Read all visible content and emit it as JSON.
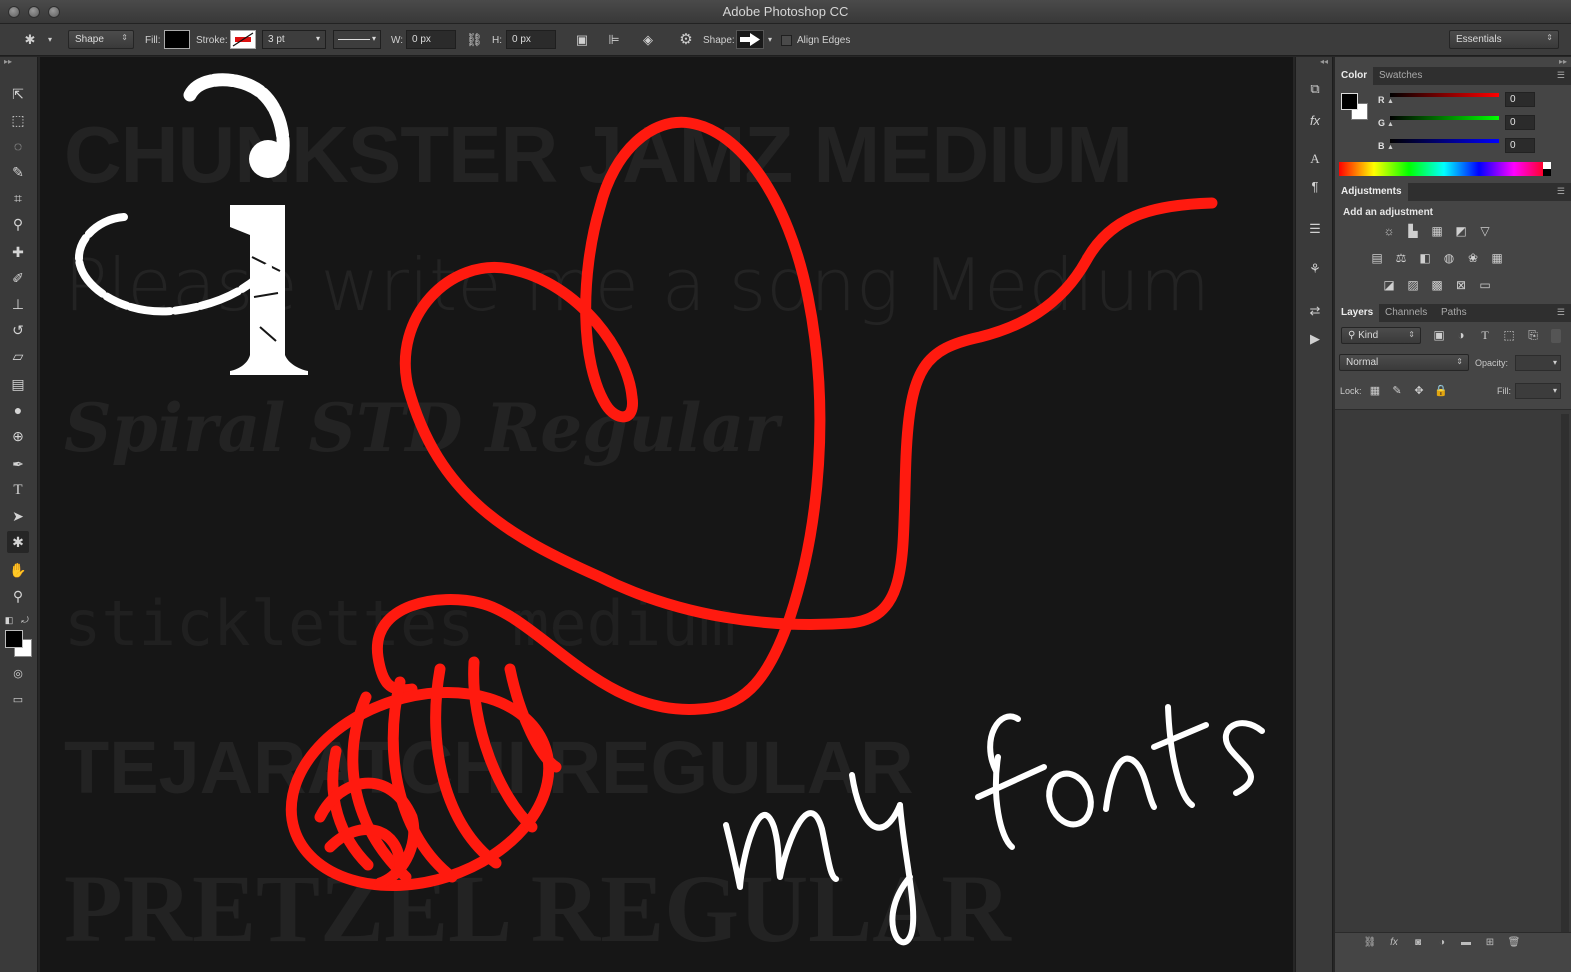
{
  "window": {
    "title": "Adobe Photoshop CC"
  },
  "options_bar": {
    "mode": "Shape",
    "fill_label": "Fill:",
    "stroke_label": "Stroke:",
    "stroke_width": "3 pt",
    "w_label": "W:",
    "w_value": "0 px",
    "h_label": "H:",
    "h_value": "0 px",
    "shape_label": "Shape:",
    "align_edges_label": "Align Edges",
    "workspace": "Essentials"
  },
  "canvas": {
    "ghost_texts": [
      "CHUNKSTER JAMZ MEDIUM",
      "Please write me a song Medium",
      "Spiral STD Regular",
      "sticklettes medium",
      "TEJARATCHI REGULAR",
      "PRETZEL REGULAR"
    ],
    "art": {
      "letter": "i",
      "script": "my fonts"
    }
  },
  "color_panel": {
    "tabs": [
      "Color",
      "Swatches"
    ],
    "channels": [
      {
        "label": "R",
        "value": "0"
      },
      {
        "label": "G",
        "value": "0"
      },
      {
        "label": "B",
        "value": "0"
      }
    ]
  },
  "adjustments_panel": {
    "tab": "Adjustments",
    "heading": "Add an adjustment"
  },
  "layers_panel": {
    "tabs": [
      "Layers",
      "Channels",
      "Paths"
    ],
    "filter_kind": "Kind",
    "blend_mode": "Normal",
    "opacity_label": "Opacity:",
    "lock_label": "Lock:",
    "fill_label": "Fill:"
  },
  "colors": {
    "stroke_red": "#ff1a0f",
    "art_white": "#ffffff",
    "canvas_bg": "#161616"
  }
}
